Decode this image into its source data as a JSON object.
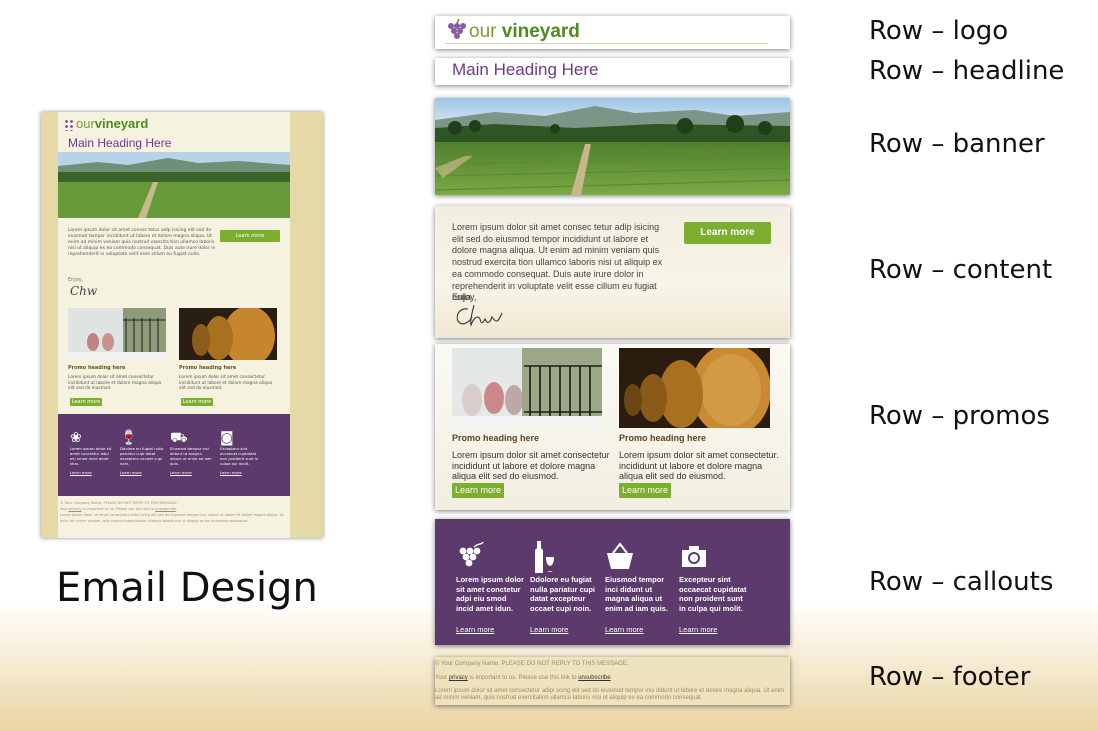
{
  "email": {
    "logo_our": "our",
    "logo_brand": "vineyard",
    "heading": "Main Heading Here",
    "content_text": "Lorem ipsum dolor sit amet consec tetur adip isicing elit sed do eiusmod tempor incididunt ut labore et dolore magna aliqua. Ut enim ad minim veniam quis nostrud exercita tion ullamco laboris nisi ut aliquip ex ea commodo consequat. Duis aute irure dolor in reprehenderit in voluptate velit esse cillum eu fugiat nulla.",
    "cta_label": "Learn more",
    "enjoy": "Enjoy,",
    "signature": "Chw",
    "promos": [
      {
        "heading": "Promo heading here",
        "text": "Lorem ipsum dolor sit amet consectetur incididunt ut labore et dolore magna aliqua elit sed do eiusmod.",
        "button": "Learn more"
      },
      {
        "heading": "Promo heading here",
        "text": "Lorem ipsum dolor sit amet consectetur. incididunt ut labore et dolore magna aliqua elit sed do eiusmod.",
        "button": "Learn more"
      }
    ],
    "callouts": [
      {
        "icon": "grapes-icon",
        "text": "Lorem ipsum dolor sit amet conctetur adpi eiu smod incid amet idun.",
        "link": "Learn more"
      },
      {
        "icon": "wine-bottle-glass-icon",
        "text": "Ddolore eu fugiat nulla pariatur cupi datat excepteur occaet cupi noin.",
        "link": "Learn more"
      },
      {
        "icon": "shopping-basket-icon",
        "text": "Eiusmod tempor inci didunt ut magna aliqua ut enim ad iam quis.",
        "link": "Learn more"
      },
      {
        "icon": "camera-icon",
        "text": "Excepteur sint occaecat cupidatat non proident sunt in culpa qui molit.",
        "link": "Learn more"
      }
    ],
    "footer": {
      "line1": "© Your Company Name. PLEASE DO NOT REPLY TO THIS MESSAGE.",
      "line2_pre": "Your",
      "line2_privacy": "privacy",
      "line2_mid": "is important to us. Please use this link to",
      "line2_unsub": "unsubscribe",
      "line3": "Lorem ipsum dolor sit amet consectetur adipi scing elit sed do eiusmod tempor inci didunt ut labore et dolore magna aliqua. Ut enim ad minim veniam, quis nostrud exercitation ullamco laboris nisi ut aliquip ex ea commodo consequat."
    }
  },
  "labels": {
    "email_design": "Email Design",
    "rows": [
      "Row – logo",
      "Row – headline",
      "Row – banner",
      "Row – content",
      "Row – promos",
      "Row – callouts",
      "Row – footer"
    ]
  },
  "colors": {
    "purple": "#5c3a6c",
    "green_button": "#7cae2f",
    "heading_purple": "#6b3a8c",
    "cream": "#f6f2e0",
    "footer_tan": "#efe3bd"
  }
}
